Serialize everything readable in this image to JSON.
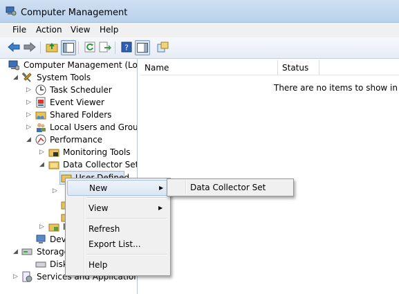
{
  "window": {
    "title": "Computer Management"
  },
  "menu": [
    "File",
    "Action",
    "View",
    "Help"
  ],
  "toolbar": {
    "icons": [
      "back-icon",
      "forward-icon",
      "up-folder-icon",
      "show-hide-tree-icon",
      "refresh-icon",
      "export-list-icon",
      "help-icon",
      "show-hide-action-pane-icon",
      "properties-icon"
    ]
  },
  "tree": {
    "root": "Computer Management (Local",
    "system_tools": "System Tools",
    "task_scheduler": "Task Scheduler",
    "event_viewer": "Event Viewer",
    "shared_folders": "Shared Folders",
    "local_users": "Local Users and Groups",
    "performance": "Performance",
    "monitoring_tools": "Monitoring Tools",
    "data_collector_sets": "Data Collector Sets",
    "user_defined": "User Defined",
    "dev_partial": "Dev",
    "storage_partial": "Storage",
    "disk_partial": "Disk",
    "services": "Services and Applications",
    "hidden_item_partial": "I"
  },
  "list": {
    "columns": [
      "Name",
      "Status"
    ],
    "empty_message": "There are no items to show in this"
  },
  "context_menu": {
    "items": [
      "New",
      "View",
      "Refresh",
      "Export List...",
      "Help"
    ],
    "highlighted": "New"
  },
  "submenu": {
    "items": [
      "Data Collector Set"
    ]
  }
}
